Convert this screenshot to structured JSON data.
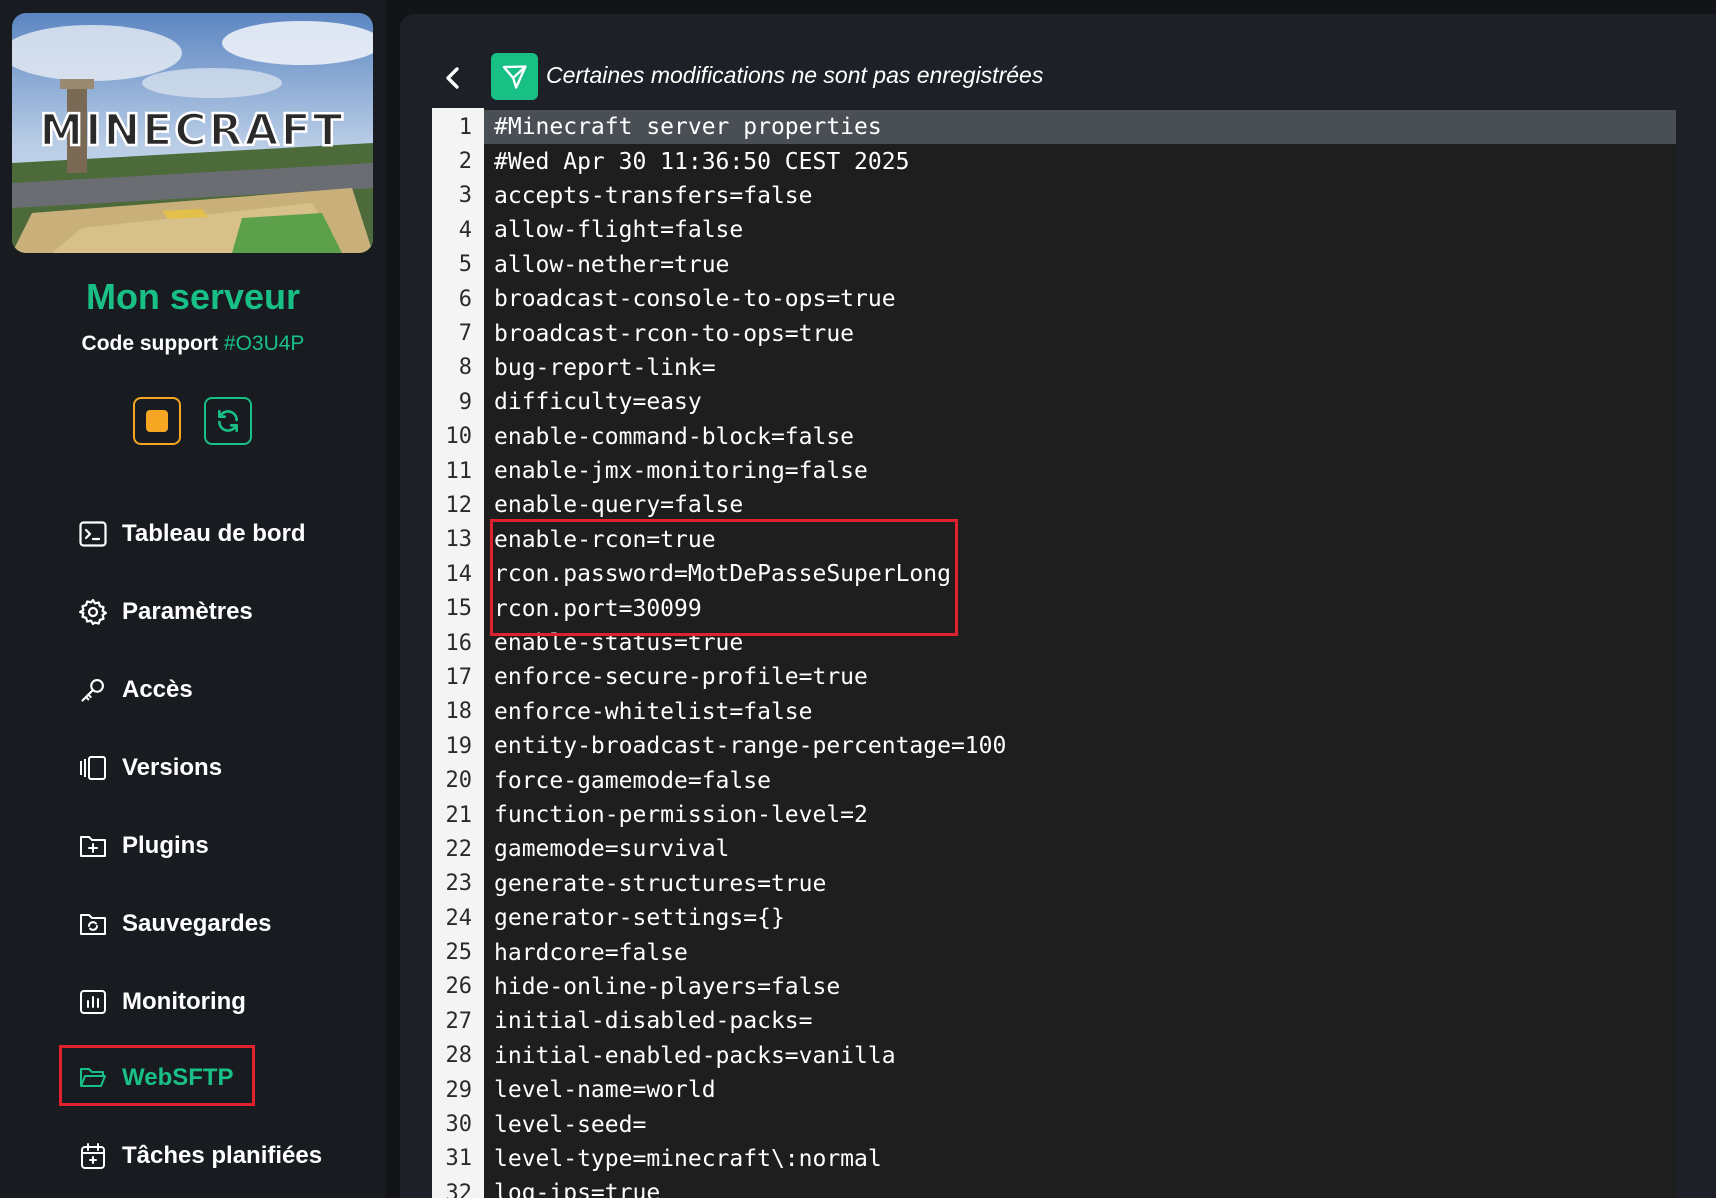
{
  "sidebar": {
    "server_name": "Mon serveur",
    "support_label": "Code support",
    "support_code": "#O3U4P",
    "logo_text": "MINECRAFT",
    "controls": {
      "stop_icon": "stop-square-icon",
      "restart_icon": "refresh-icon"
    },
    "items": [
      {
        "label": "Tableau de bord",
        "icon": "terminal-icon"
      },
      {
        "label": "Paramètres",
        "icon": "gear-icon"
      },
      {
        "label": "Accès",
        "icon": "key-icon"
      },
      {
        "label": "Versions",
        "icon": "versions-icon"
      },
      {
        "label": "Plugins",
        "icon": "folder-plus-icon"
      },
      {
        "label": "Sauvegardes",
        "icon": "backup-folder-icon"
      },
      {
        "label": "Monitoring",
        "icon": "chart-icon"
      },
      {
        "label": "WebSFTP",
        "icon": "folder-open-icon",
        "active": true
      },
      {
        "label": "Tâches planifiées",
        "icon": "calendar-icon"
      }
    ]
  },
  "editor": {
    "notice": "Certaines modifications ne sont pas enregistrées",
    "lines": [
      "#Minecraft server properties",
      "#Wed Apr 30 11:36:50 CEST 2025",
      "accepts-transfers=false",
      "allow-flight=false",
      "allow-nether=true",
      "broadcast-console-to-ops=true",
      "broadcast-rcon-to-ops=true",
      "bug-report-link=",
      "difficulty=easy",
      "enable-command-block=false",
      "enable-jmx-monitoring=false",
      "enable-query=false",
      "enable-rcon=true",
      "rcon.password=MotDePasseSuperLong",
      "rcon.port=30099",
      "enable-status=true",
      "enforce-secure-profile=true",
      "enforce-whitelist=false",
      "entity-broadcast-range-percentage=100",
      "force-gamemode=false",
      "function-permission-level=2",
      "gamemode=survival",
      "generate-structures=true",
      "generator-settings={}",
      "hardcore=false",
      "hide-online-players=false",
      "initial-disabled-packs=",
      "initial-enabled-packs=vanilla",
      "level-name=world",
      "level-seed=",
      "level-type=minecraft\\:normal",
      "log-ips=true"
    ]
  },
  "colors": {
    "accent": "#18c085",
    "warning": "#f5a623",
    "annotation": "#e0212e"
  }
}
